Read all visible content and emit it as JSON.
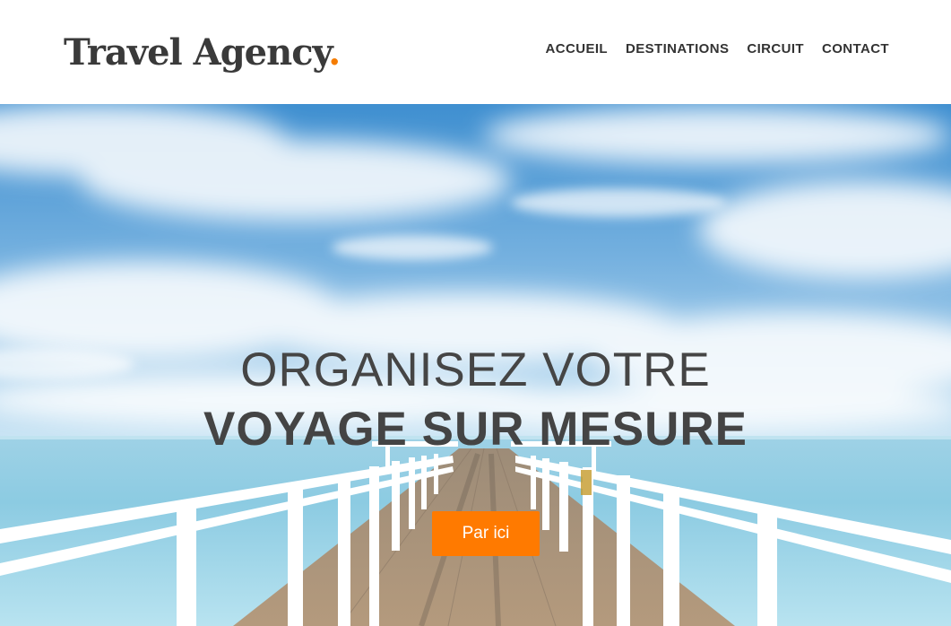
{
  "brand": {
    "name": "Travel Agency",
    "dot": ".",
    "dot_color": "#f57c00"
  },
  "nav": {
    "items": [
      {
        "label": "ACCUEIL"
      },
      {
        "label": "DESTINATIONS"
      },
      {
        "label": "CIRCUIT"
      },
      {
        "label": "CONTACT"
      }
    ]
  },
  "hero": {
    "headline_line1": "ORGANISEZ VOTRE",
    "headline_line2": "VOYAGE SUR MESURE",
    "cta_label": "Par ici",
    "cta_color": "#ff7a00",
    "background": "pier-over-ocean-photo"
  }
}
